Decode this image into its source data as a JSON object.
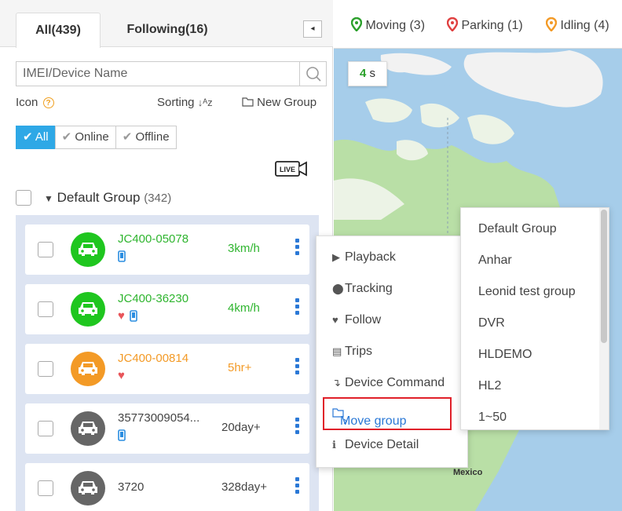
{
  "tabs": {
    "all": "All(439)",
    "following": "Following(16)",
    "collapse_glyph": "◂"
  },
  "search": {
    "placeholder": "IMEI/Device Name"
  },
  "toolbar": {
    "icon_label": "Icon",
    "sorting_label": "Sorting",
    "sort_glyph": "↓ᴬᴢ",
    "new_group_label": "New Group"
  },
  "filters": [
    {
      "label": "All",
      "selected": true
    },
    {
      "label": "Online",
      "selected": false
    },
    {
      "label": "Offline",
      "selected": false
    }
  ],
  "live_label": "LIVE",
  "group": {
    "name": "Default Group",
    "count": "(342)"
  },
  "devices": [
    {
      "name": "JC400-05078",
      "speed": "3km/h",
      "status_color": "#1fc61f",
      "name_color": "#2fb52f",
      "heart": false,
      "phone": true
    },
    {
      "name": "JC400-36230",
      "speed": "4km/h",
      "status_color": "#1fc61f",
      "name_color": "#2fb52f",
      "heart": true,
      "phone": true
    },
    {
      "name": "JC400-00814",
      "speed": "5hr+",
      "status_color": "#f39a26",
      "name_color": "#f39a26",
      "heart": true,
      "phone": false
    },
    {
      "name": "35773009054...",
      "speed": "20day+",
      "status_color": "#666666",
      "name_color": "#444444",
      "heart": false,
      "phone": true
    },
    {
      "name": "3720",
      "speed": "328day+",
      "status_color": "#666666",
      "name_color": "#444444",
      "heart": false,
      "phone": false
    }
  ],
  "legend": {
    "moving": "Moving (3)",
    "parking": "Parking (1)",
    "idling": "Idling (4)"
  },
  "legend_colors": {
    "moving": "#2ca02c",
    "parking": "#e04040",
    "idling": "#f39a26"
  },
  "refresh": {
    "value": "4",
    "unit": "s"
  },
  "map_label": "Mexico",
  "context_menu": {
    "playback": "Playback",
    "tracking": "Tracking",
    "follow": "Follow",
    "trips": "Trips",
    "device_command": "Device Command",
    "move_group": "Move group",
    "move_group_arrow": "›",
    "device_detail": "Device Detail"
  },
  "submenu": [
    "Default Group",
    "Anhar",
    "Leonid test group",
    "DVR",
    "HLDEMO",
    "HL2",
    "1~50"
  ]
}
